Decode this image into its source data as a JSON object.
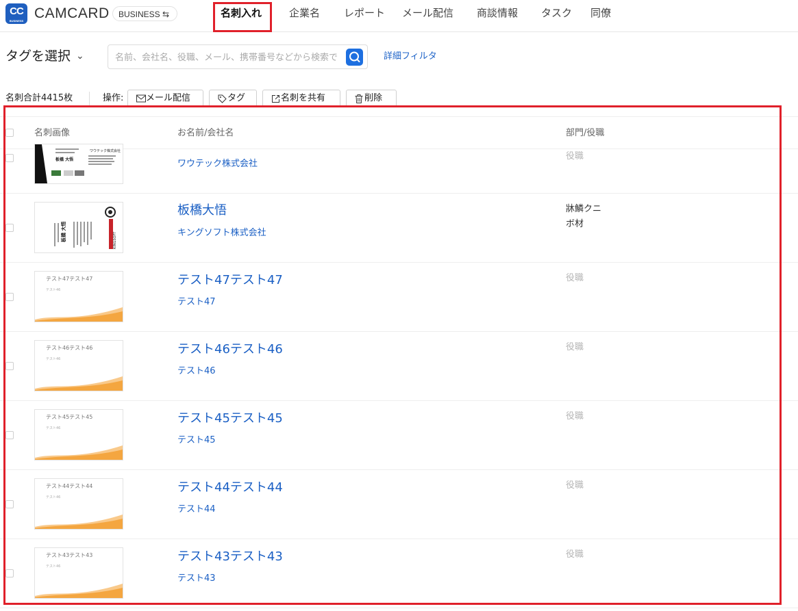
{
  "app": {
    "logo_text": "CC",
    "logo_sub": "BUSINESS",
    "brand": "CAMCARD",
    "edition": "BUSINESS ⇆"
  },
  "nav": [
    {
      "label": "名刺入れ",
      "active": true
    },
    {
      "label": "企業名"
    },
    {
      "label": "レポート"
    },
    {
      "label": "メール配信"
    },
    {
      "label": "商談情報"
    },
    {
      "label": "タスク"
    },
    {
      "label": "同僚"
    }
  ],
  "filter": {
    "tag_select": "タグを選択",
    "search_placeholder": "名前、会社名、役職、メール、携帯番号などから検索で",
    "advanced_filter": "詳細フィルタ"
  },
  "toolbar": {
    "total": "名刺合計4415枚",
    "ops_label": "操作:",
    "buttons": [
      {
        "label": "メール配信",
        "icon": "mail-icon"
      },
      {
        "label": "タグ",
        "icon": "tag-icon"
      },
      {
        "label": "名刺を共有",
        "icon": "share-icon"
      },
      {
        "label": "削除",
        "icon": "trash-icon"
      }
    ]
  },
  "table": {
    "columns": [
      "名刺画像",
      "お名前/会社名",
      "部門/役職"
    ],
    "rows": [
      {
        "name": "",
        "company": "ワウテック株式会社",
        "dept": "役職",
        "dept_muted": true,
        "thumb": "wowtech"
      },
      {
        "name": "板橋大悟",
        "company": "キングソフト株式会社",
        "dept": "牀鱗クニ",
        "dept2": "ボ材",
        "dept_muted": false,
        "thumb": "kingsoft"
      },
      {
        "name": "テスト47テスト47",
        "company": "テスト47",
        "dept": "役職",
        "dept_muted": true,
        "thumb_text": "テスト47テスト47"
      },
      {
        "name": "テスト46テスト46",
        "company": "テスト46",
        "dept": "役職",
        "dept_muted": true,
        "thumb_text": "テスト46テスト46"
      },
      {
        "name": "テスト45テスト45",
        "company": "テスト45",
        "dept": "役職",
        "dept_muted": true,
        "thumb_text": "テスト45テスト45"
      },
      {
        "name": "テスト44テスト44",
        "company": "テスト44",
        "dept": "役職",
        "dept_muted": true,
        "thumb_text": "テスト44テスト44"
      },
      {
        "name": "テスト43テスト43",
        "company": "テスト43",
        "dept": "役職",
        "dept_muted": true,
        "thumb_text": "テスト43テスト43"
      }
    ]
  },
  "thumb_lettering": {
    "wowtech_company": "ワウテック株式会社",
    "wowtech_name": "板橋 大悟",
    "kingsoft_name": "板橋 大悟",
    "kingsoft_logo": "KINGSOFT",
    "test_sub": "テスト46"
  },
  "colors": {
    "highlight": "#e0202a",
    "link": "#1a5fc4",
    "accent": "#1d6fe0",
    "card_wave": "#f4a640"
  }
}
